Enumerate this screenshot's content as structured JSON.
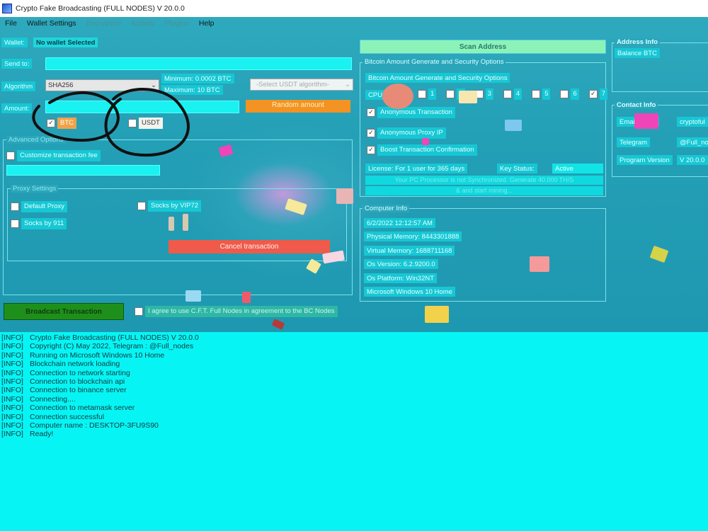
{
  "window": {
    "title": "Crypto Fake Broadcasting (FULL NODES) V 20.0.0"
  },
  "menu": [
    "File",
    "Wallet Settings",
    "Encryption",
    "Activity",
    "Plugins",
    "Help"
  ],
  "wallet": {
    "label": "Wallet:",
    "value": "No wallet Selected"
  },
  "send": {
    "label": "Send to:",
    "value": ""
  },
  "algorithm": {
    "label": "Algorithm",
    "value": "SHA256",
    "minimum": "Minimum: 0.0002 BTC",
    "maximum": "Maximum: 10 BTC",
    "usdt_placeholder": "-Select USDT algorithm-"
  },
  "amount": {
    "label": "Amount:",
    "value": "",
    "random_button": "Random amount",
    "btc": "BTC",
    "usdt": "USDT"
  },
  "advanced": {
    "title": "Advanced Options",
    "customize_fee": "Customize transaction fee"
  },
  "proxy": {
    "title": "Proxy Settings",
    "default": "Default Proxy",
    "vip72": "Socks by VIP72",
    "s911": "Socks by 911"
  },
  "cancel_button": "Cancel transaction",
  "broadcast_button": "Broadcast Transaction",
  "agree_text": "I agree to use C.F.T. Full Nodes in agreement to the BC Nodes",
  "scan_button": "Scan Address",
  "security": {
    "title": "Bitcoin Amount Generate and Security Options",
    "header": "Bitcoin Amount Generate and Security Options",
    "cpu_label": "CPU Affinity",
    "cpu": [
      {
        "n": "1",
        "c": false
      },
      {
        "n": "2",
        "c": false
      },
      {
        "n": "3",
        "c": false
      },
      {
        "n": "4",
        "c": false
      },
      {
        "n": "5",
        "c": false
      },
      {
        "n": "6",
        "c": false
      },
      {
        "n": "7",
        "c": true
      }
    ],
    "anon_tx": "Anonymous Transaction",
    "anon_proxy": "Anonymous Proxy IP",
    "boost": "Boost Transaction Confirmation",
    "license": "License: For 1 user for 365 days",
    "key_label": "Key Status:",
    "key_value": "Active",
    "status1": "Your PC Processor is not Synchronized. Generate 40.000 TH/S",
    "status2": "& and start mining",
    "status2_suffix": "..."
  },
  "computer": {
    "title": "Computer Info",
    "items": [
      "6/2/2022 12:12:57 AM",
      "Physical Memory: 8443301888",
      "Virtual Memory: 1688711168",
      "Os Version: 6.2.9200.0",
      "Os Platform: Win32NT",
      "Microsoft Windows 10 Home"
    ]
  },
  "address_info": {
    "title": "Address Info",
    "balance": "Balance BTC"
  },
  "contact": {
    "title": "Contact Info",
    "email_label": "Email",
    "email_value": "cryptoful",
    "telegram_label": "Telegram",
    "telegram_value": "@Full_no",
    "version_label": "Program Version",
    "version_value": "V 20.0.0"
  },
  "log": {
    "tag": "[INFO]",
    "lines": [
      "Crypto Fake Broadcasting (FULL NODES) V 20.0.0",
      "Copyright (C) May 2022, Telegram : @Full_nodes",
      "Running on Microsoft Windows 10 Home",
      "Blockchain network loading",
      "Connection to network starting",
      "Connection to blockchain api",
      "Connection to binance server",
      "Connecting....",
      "Connection to metamask server",
      "Connection successful",
      "Computer name : DESKTOP-3FU9S90",
      "Ready!"
    ]
  },
  "colors": {
    "panel": "#239fb6",
    "field": "#19f2f0",
    "log_bg": "#06f5f4",
    "random_btn": "#f29323",
    "cancel_btn": "#ef5a4a",
    "broadcast_btn": "#1f8f1b",
    "scan_btn": "#8cf3b8"
  }
}
